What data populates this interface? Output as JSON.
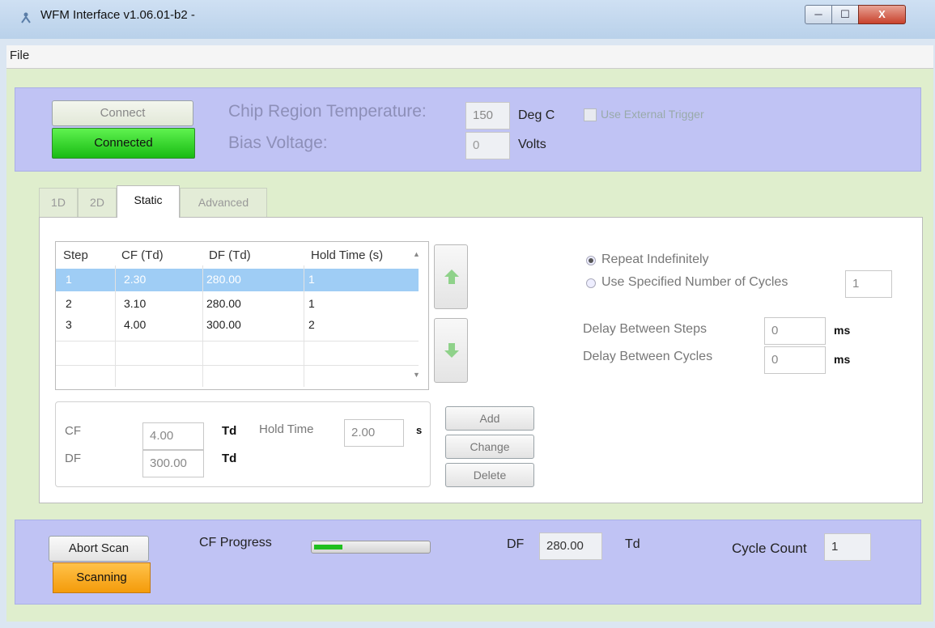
{
  "window": {
    "title": "WFM Interface v1.06.01-b2 -",
    "min_label": "─",
    "max_label": "☐",
    "close_label": "X"
  },
  "menu": {
    "file": "File"
  },
  "top": {
    "connect_label": "Connect",
    "connected_label": "Connected",
    "chip_temp_label": "Chip Region Temperature:",
    "chip_temp_value": "150",
    "chip_temp_unit": "Deg C",
    "bias_label": "Bias Voltage:",
    "bias_value": "0",
    "bias_unit": "Volts",
    "external_trigger_label": "Use External Trigger",
    "external_trigger_checked": false
  },
  "tabs": [
    {
      "label": "1D"
    },
    {
      "label": "2D"
    },
    {
      "label": "Static"
    },
    {
      "label": "Advanced"
    }
  ],
  "table": {
    "headers": [
      "Step",
      "CF (Td)",
      "DF (Td)",
      "Hold Time (s)"
    ],
    "rows": [
      [
        "1",
        "2.30",
        "280.00",
        "1"
      ],
      [
        "2",
        "3.10",
        "280.00",
        "1"
      ],
      [
        "3",
        "4.00",
        "300.00",
        "2"
      ]
    ],
    "selected_row": 0
  },
  "editor": {
    "cf_label": "CF",
    "cf_value": "4.00",
    "cf_unit": "Td",
    "df_label": "DF",
    "df_value": "300.00",
    "df_unit": "Td",
    "hold_label": "Hold Time",
    "hold_value": "2.00",
    "hold_unit": "s",
    "add_label": "Add",
    "change_label": "Change",
    "delete_label": "Delete"
  },
  "options": {
    "repeat_label": "Repeat Indefinitely",
    "repeat_selected": true,
    "cycles_label": "Use Specified Number of Cycles",
    "cycles_value": "1",
    "delay_steps_label": "Delay Between Steps",
    "delay_steps_value": "0",
    "delay_steps_unit": "ms",
    "delay_cycles_label": "Delay Between Cycles",
    "delay_cycles_value": "0",
    "delay_cycles_unit": "ms"
  },
  "bottom": {
    "abort_label": "Abort Scan",
    "scanning_label": "Scanning",
    "cf_progress_label": "CF Progress",
    "cf_progress_fraction": 0.25,
    "df_label": "DF",
    "df_value": "280.00",
    "df_unit": "Td",
    "cycle_label": "Cycle Count",
    "cycle_value": "1"
  },
  "colors": {
    "panel_blue": "#c0c3f4",
    "background_green": "#dfeecd",
    "connected_green": "#22cc1a",
    "scanning_orange": "#f7a81f",
    "selection_blue": "#9fcdf5"
  }
}
